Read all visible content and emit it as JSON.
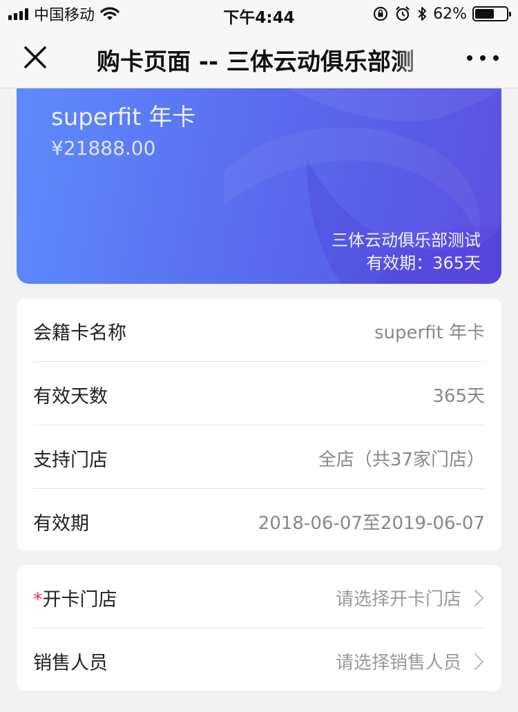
{
  "status_bar": {
    "carrier": "中国移动",
    "time": "下午4:44",
    "battery_pct": "62%",
    "battery_level": 0.62,
    "icons": [
      "signal-icon",
      "wifi-icon",
      "lock-rotation-icon",
      "alarm-icon",
      "bluetooth-icon",
      "battery-icon"
    ]
  },
  "nav": {
    "title": "购卡页面 -- 三体云动俱乐部测",
    "close_icon": "close-icon",
    "more_icon": "more-icon"
  },
  "card": {
    "name": "superfit 年卡",
    "price": "¥21888.00",
    "club": "三体云动俱乐部测试",
    "validity": "有效期：365天",
    "gradient": [
      "#5d8bfb",
      "#5a6ff1",
      "#5c4fe0"
    ]
  },
  "details": [
    {
      "label": "会籍卡名称",
      "value": "superfit 年卡"
    },
    {
      "label": "有效天数",
      "value": "365天"
    },
    {
      "label": "支持门店",
      "value": "全店（共37家门店）"
    },
    {
      "label": "有效期",
      "value": "2018-06-07至2019-06-07"
    }
  ],
  "selectors": {
    "store": {
      "required_mark": "*",
      "label": "开卡门店",
      "placeholder": "请选择开卡门店"
    },
    "sales": {
      "label": "销售人员",
      "placeholder": "请选择销售人员"
    }
  },
  "colors": {
    "required": "#e23a3a",
    "value_text": "#888888",
    "background": "#f2f2f2"
  }
}
